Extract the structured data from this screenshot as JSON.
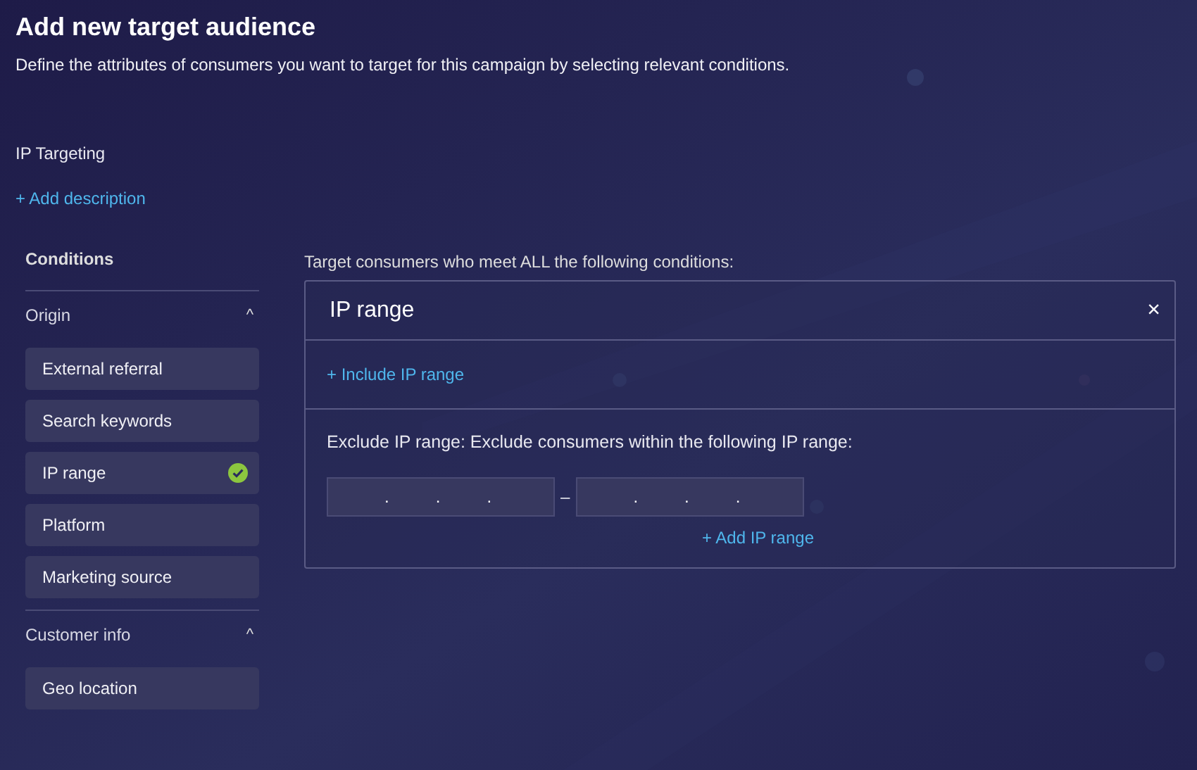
{
  "header": {
    "title": "Add new target audience",
    "subtitle": "Define the attributes of consumers you want to target for this campaign by selecting relevant conditions."
  },
  "audience": {
    "name": "IP Targeting",
    "add_description": "+ Add description"
  },
  "conditions": {
    "heading": "Conditions",
    "groups": [
      {
        "label": "Origin",
        "expanded": true,
        "toggle": "^",
        "items": [
          {
            "label": "External referral",
            "done": false
          },
          {
            "label": "Search keywords",
            "done": false
          },
          {
            "label": "IP range",
            "done": true
          },
          {
            "label": "Platform",
            "done": false
          },
          {
            "label": "Marketing source",
            "done": false
          }
        ]
      },
      {
        "label": "Customer info",
        "expanded": true,
        "toggle": "^",
        "items": [
          {
            "label": "Geo location",
            "done": false
          }
        ]
      }
    ]
  },
  "rules": {
    "intro": "Target consumers who meet ALL the following conditions:",
    "card": {
      "title": "IP range",
      "close": "×",
      "include_link": "+ Include IP range",
      "exclude_text": "Exclude IP range: Exclude consumers within the following IP range:",
      "ranges": [
        {
          "from_separators": [
            ".",
            ".",
            "."
          ],
          "dash": "–",
          "to_separators": [
            ".",
            ".",
            "."
          ]
        }
      ],
      "add_link": "+ Add IP range"
    }
  }
}
